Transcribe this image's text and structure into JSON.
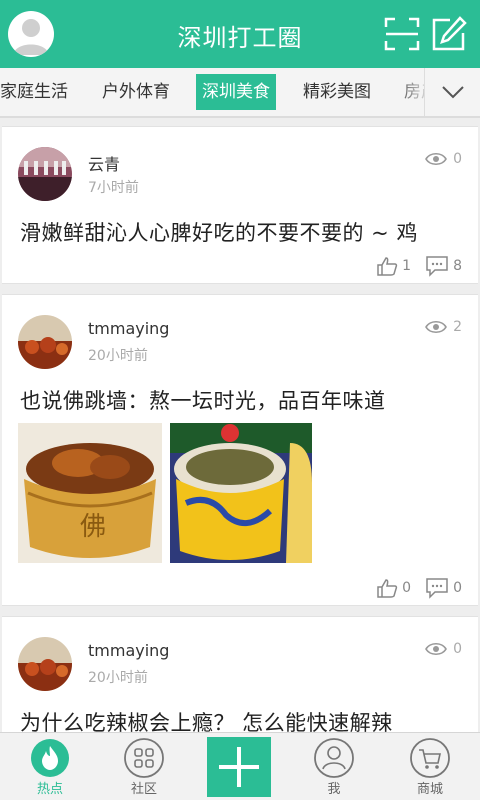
{
  "header": {
    "title": "深圳打工圈"
  },
  "tabs": [
    "家庭生活",
    "户外体育",
    "深圳美食",
    "精彩美图",
    "房产"
  ],
  "active_tab": "深圳美食",
  "posts": [
    {
      "author": "云青",
      "time": "7小时前",
      "views": "0",
      "text": "滑嫩鲜甜沁人心脾好吃的不要不要的 ~ 鸡",
      "likes": "1",
      "comments": "8"
    },
    {
      "author": "tmmaying",
      "time": "20小时前",
      "views": "2",
      "text": "也说佛跳墙：熬一坛时光，品百年味道",
      "likes": "0",
      "comments": "0"
    },
    {
      "author": "tmmaying",
      "time": "20小时前",
      "views": "0",
      "text": "为什么吃辣椒会上瘾？ 怎么能快速解辣"
    }
  ],
  "bottom_nav": {
    "hot": "热点",
    "community": "社区",
    "me": "我",
    "mall": "商城"
  },
  "colors": {
    "accent": "#2bbd95",
    "background": "#eeeeee"
  }
}
